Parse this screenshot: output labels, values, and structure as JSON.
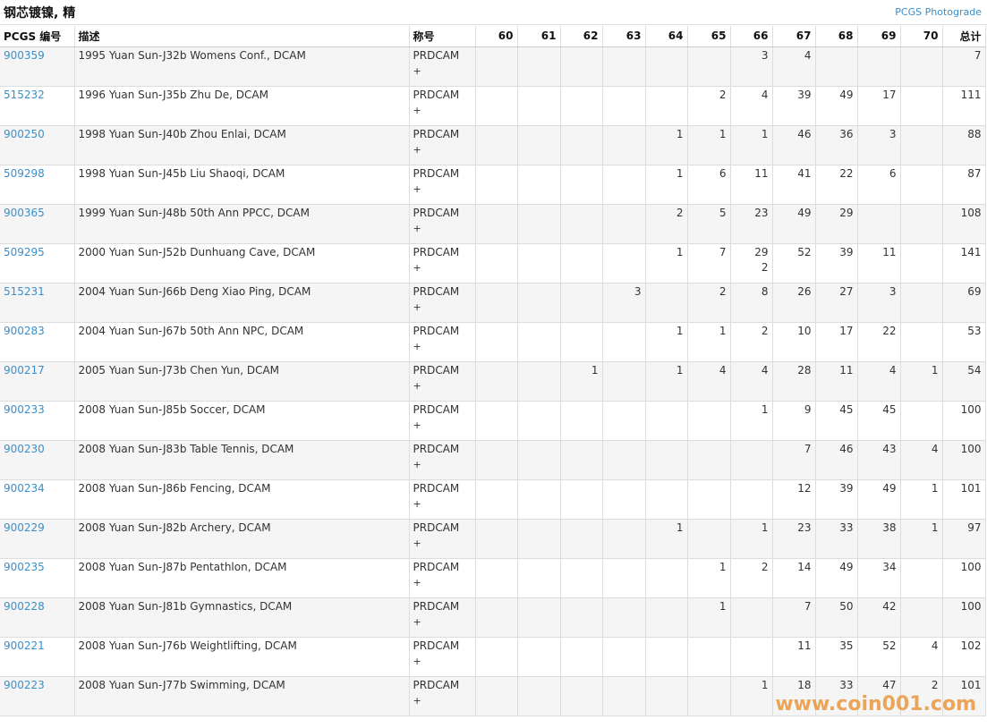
{
  "header": {
    "title": "钢芯镀镍, 精",
    "photograde_link": "PCGS Photograde"
  },
  "columns": [
    "PCGS 编号",
    "描述",
    "称号",
    "60",
    "61",
    "62",
    "63",
    "64",
    "65",
    "66",
    "67",
    "68",
    "69",
    "70",
    "总计"
  ],
  "rows": [
    {
      "id": "900359",
      "desc": "1995 Yuan Sun-J32b Womens Conf., DCAM",
      "designation": "PRDCAM",
      "plus": "+",
      "g60": "",
      "g61": "",
      "g62": "",
      "g63": "",
      "g64": "",
      "g65": "",
      "g66": "3",
      "g66b": "",
      "g67": "4",
      "g68": "",
      "g69": "",
      "g70": "",
      "total": "7"
    },
    {
      "id": "515232",
      "desc": "1996 Yuan Sun-J35b Zhu De, DCAM",
      "designation": "PRDCAM",
      "plus": "+",
      "g60": "",
      "g61": "",
      "g62": "",
      "g63": "",
      "g64": "",
      "g65": "2",
      "g66": "4",
      "g66b": "",
      "g67": "39",
      "g68": "49",
      "g69": "17",
      "g70": "",
      "total": "111"
    },
    {
      "id": "900250",
      "desc": "1998 Yuan Sun-J40b Zhou Enlai, DCAM",
      "designation": "PRDCAM",
      "plus": "+",
      "g60": "",
      "g61": "",
      "g62": "",
      "g63": "",
      "g64": "1",
      "g65": "1",
      "g66": "1",
      "g66b": "",
      "g67": "46",
      "g68": "36",
      "g69": "3",
      "g70": "",
      "total": "88"
    },
    {
      "id": "509298",
      "desc": "1998 Yuan Sun-J45b Liu Shaoqi, DCAM",
      "designation": "PRDCAM",
      "plus": "+",
      "g60": "",
      "g61": "",
      "g62": "",
      "g63": "",
      "g64": "1",
      "g65": "6",
      "g66": "11",
      "g66b": "",
      "g67": "41",
      "g68": "22",
      "g69": "6",
      "g70": "",
      "total": "87"
    },
    {
      "id": "900365",
      "desc": "1999 Yuan Sun-J48b 50th Ann PPCC, DCAM",
      "designation": "PRDCAM",
      "plus": "+",
      "g60": "",
      "g61": "",
      "g62": "",
      "g63": "",
      "g64": "2",
      "g65": "5",
      "g66": "23",
      "g66b": "",
      "g67": "49",
      "g68": "29",
      "g69": "",
      "g70": "",
      "total": "108"
    },
    {
      "id": "509295",
      "desc": "2000 Yuan Sun-J52b Dunhuang Cave, DCAM",
      "designation": "PRDCAM",
      "plus": "+",
      "g60": "",
      "g61": "",
      "g62": "",
      "g63": "",
      "g64": "1",
      "g65": "7",
      "g66": "29",
      "g66b": "2",
      "g67": "52",
      "g68": "39",
      "g69": "11",
      "g70": "",
      "total": "141"
    },
    {
      "id": "515231",
      "desc": "2004 Yuan Sun-J66b Deng Xiao Ping, DCAM",
      "designation": "PRDCAM",
      "plus": "+",
      "g60": "",
      "g61": "",
      "g62": "",
      "g63": "3",
      "g64": "",
      "g65": "2",
      "g66": "8",
      "g66b": "",
      "g67": "26",
      "g68": "27",
      "g69": "3",
      "g70": "",
      "total": "69"
    },
    {
      "id": "900283",
      "desc": "2004 Yuan Sun-J67b 50th Ann NPC, DCAM",
      "designation": "PRDCAM",
      "plus": "+",
      "g60": "",
      "g61": "",
      "g62": "",
      "g63": "",
      "g64": "1",
      "g65": "1",
      "g66": "2",
      "g66b": "",
      "g67": "10",
      "g68": "17",
      "g69": "22",
      "g70": "",
      "total": "53"
    },
    {
      "id": "900217",
      "desc": "2005 Yuan Sun-J73b Chen Yun, DCAM",
      "designation": "PRDCAM",
      "plus": "+",
      "g60": "",
      "g61": "",
      "g62": "1",
      "g63": "",
      "g64": "1",
      "g65": "4",
      "g66": "4",
      "g66b": "",
      "g67": "28",
      "g68": "11",
      "g69": "4",
      "g70": "1",
      "total": "54"
    },
    {
      "id": "900233",
      "desc": "2008 Yuan Sun-J85b Soccer, DCAM",
      "designation": "PRDCAM",
      "plus": "+",
      "g60": "",
      "g61": "",
      "g62": "",
      "g63": "",
      "g64": "",
      "g65": "",
      "g66": "1",
      "g66b": "",
      "g67": "9",
      "g68": "45",
      "g69": "45",
      "g70": "",
      "total": "100"
    },
    {
      "id": "900230",
      "desc": "2008 Yuan Sun-J83b Table Tennis, DCAM",
      "designation": "PRDCAM",
      "plus": "+",
      "g60": "",
      "g61": "",
      "g62": "",
      "g63": "",
      "g64": "",
      "g65": "",
      "g66": "",
      "g66b": "",
      "g67": "7",
      "g68": "46",
      "g69": "43",
      "g70": "4",
      "total": "100"
    },
    {
      "id": "900234",
      "desc": "2008 Yuan Sun-J86b Fencing, DCAM",
      "designation": "PRDCAM",
      "plus": "+",
      "g60": "",
      "g61": "",
      "g62": "",
      "g63": "",
      "g64": "",
      "g65": "",
      "g66": "",
      "g66b": "",
      "g67": "12",
      "g68": "39",
      "g69": "49",
      "g70": "1",
      "total": "101"
    },
    {
      "id": "900229",
      "desc": "2008 Yuan Sun-J82b Archery, DCAM",
      "designation": "PRDCAM",
      "plus": "+",
      "g60": "",
      "g61": "",
      "g62": "",
      "g63": "",
      "g64": "1",
      "g65": "",
      "g66": "1",
      "g66b": "",
      "g67": "23",
      "g68": "33",
      "g69": "38",
      "g70": "1",
      "total": "97"
    },
    {
      "id": "900235",
      "desc": "2008 Yuan Sun-J87b Pentathlon, DCAM",
      "designation": "PRDCAM",
      "plus": "+",
      "g60": "",
      "g61": "",
      "g62": "",
      "g63": "",
      "g64": "",
      "g65": "1",
      "g66": "2",
      "g66b": "",
      "g67": "14",
      "g68": "49",
      "g69": "34",
      "g70": "",
      "total": "100"
    },
    {
      "id": "900228",
      "desc": "2008 Yuan Sun-J81b Gymnastics, DCAM",
      "designation": "PRDCAM",
      "plus": "+",
      "g60": "",
      "g61": "",
      "g62": "",
      "g63": "",
      "g64": "",
      "g65": "1",
      "g66": "",
      "g66b": "",
      "g67": "7",
      "g68": "50",
      "g69": "42",
      "g70": "",
      "total": "100"
    },
    {
      "id": "900221",
      "desc": "2008 Yuan Sun-J76b Weightlifting, DCAM",
      "designation": "PRDCAM",
      "plus": "+",
      "g60": "",
      "g61": "",
      "g62": "",
      "g63": "",
      "g64": "",
      "g65": "",
      "g66": "",
      "g66b": "",
      "g67": "11",
      "g68": "35",
      "g69": "52",
      "g70": "4",
      "total": "102"
    },
    {
      "id": "900223",
      "desc": "2008 Yuan Sun-J77b Swimming, DCAM",
      "designation": "PRDCAM",
      "plus": "+",
      "g60": "",
      "g61": "",
      "g62": "",
      "g63": "",
      "g64": "",
      "g65": "",
      "g66": "1",
      "g66b": "",
      "g67": "18",
      "g68": "33",
      "g69": "47",
      "g70": "2",
      "total": "101"
    }
  ],
  "watermark": "www.coin001.com"
}
